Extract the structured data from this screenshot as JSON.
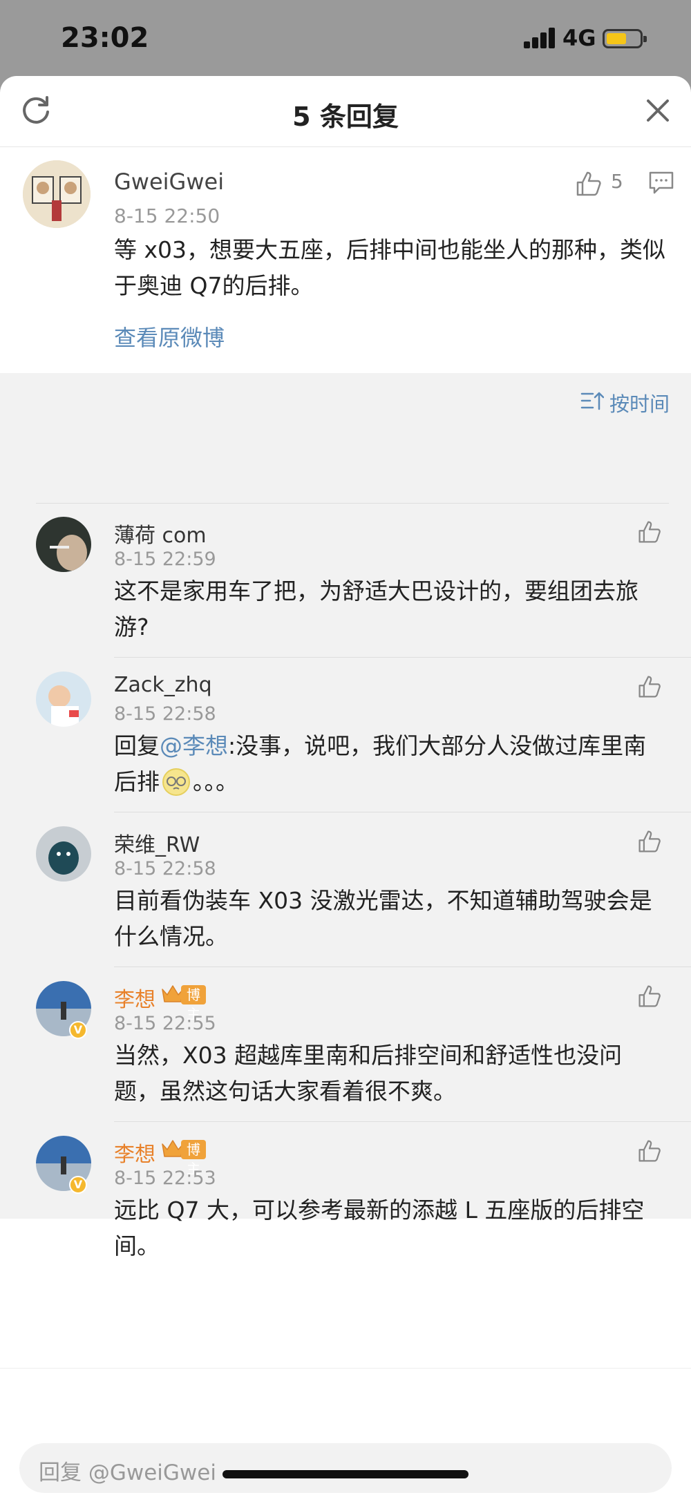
{
  "status": {
    "time": "23:02",
    "network": "4G"
  },
  "header": {
    "title": "5 条回复"
  },
  "post": {
    "username": "GweiGwei",
    "time": "8-15 22:50",
    "like_count": "5",
    "text": "等 x03，想要大五座，后排中间也能坐人的那种，类似于奥迪 Q7的后排。",
    "view_original": "查看原微博"
  },
  "sort": {
    "label": "按时间"
  },
  "replies": [
    {
      "username": "薄荷 com",
      "time": "8-15 22:59",
      "text": "这不是家用车了把，为舒适大巴设计的，要组团去旅游?"
    },
    {
      "username": "Zack_zhq",
      "time": "8-15 22:58",
      "prefix": "回复",
      "mention": "@李想",
      "text": ":没事，说吧，我们大部分人没做过库里南后排",
      "suffix": "。。。"
    },
    {
      "username": "荣维_RW",
      "time": "8-15 22:58",
      "text": "目前看伪装车 X03 没激光雷达，不知道辅助驾驶会是什么情况。"
    },
    {
      "username": "李想",
      "badge": "博主",
      "time": "8-15 22:55",
      "text": "当然，X03 超越库里南和后排空间和舒适性也没问题，虽然这句话大家看着很不爽。"
    },
    {
      "username": "李想",
      "badge": "博主",
      "time": "8-15 22:53",
      "text": "远比 Q7 大，可以参考最新的添越 L 五座版的后排空间。"
    }
  ],
  "input": {
    "placeholder": "回复 @GweiGwei"
  },
  "colors": {
    "link": "#5b8ab8",
    "blogger": "#e8812a",
    "badge": "#f0a23a"
  }
}
